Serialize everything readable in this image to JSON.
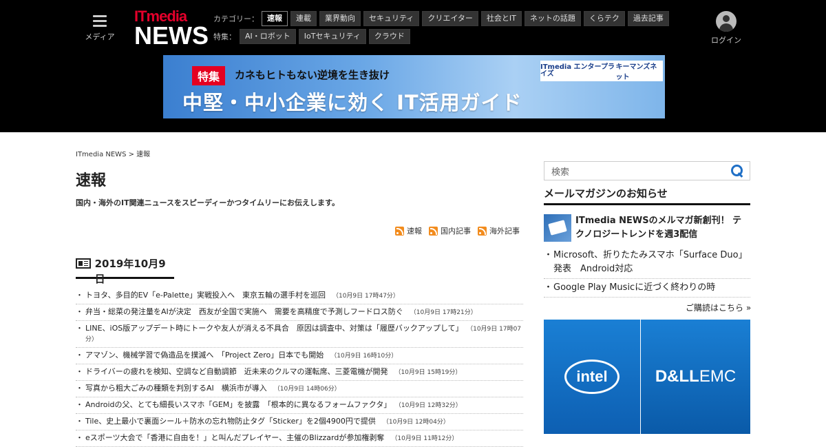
{
  "header": {
    "menu_label": "メディア",
    "logo_top": "ITmedia",
    "logo_bottom": "NEWS",
    "category_label": "カテゴリー：",
    "categories": [
      "速報",
      "連載",
      "業界動向",
      "セキュリティ",
      "クリエイター",
      "社会とIT",
      "ネットの話題",
      "くらテク",
      "過去記事"
    ],
    "feature_label": "特集：",
    "features": [
      "AI・ロボット",
      "IoTセキュリティ",
      "クラウド"
    ],
    "login_label": "ログイン"
  },
  "banner": {
    "tag": "特集",
    "subtitle": "カネもヒトもない逆境を生き抜け",
    "headline": "中堅・中小企業に効く IT活用ガイド",
    "sponsor1": "ITmedia エンタープライズ",
    "sponsor2": "キーマンズネット"
  },
  "breadcrumb": "ITmedia NEWS > 速報",
  "page_title": "速報",
  "lead": "国内・海外のIT関連ニュースをスピーディーかつタイムリーにお伝えします。",
  "feeds": [
    "速報",
    "国内記事",
    "海外記事"
  ],
  "date_heading": "2019年10月9日",
  "news": [
    {
      "title": "トヨタ、多目的EV「e-Palette」実戦投入へ　東京五輪の選手村を巡回",
      "time": "（10月9日 17時47分）"
    },
    {
      "title": "弁当・総菜の発注量をAIが決定　西友が全国で実施へ　需要を高精度で予測しフードロス防ぐ",
      "time": "（10月9日 17時21分）"
    },
    {
      "title": "LINE、iOS版アップデート時にトークや友人が消える不具合　原因は調査中、対策は「履歴バックアップして」",
      "time": "（10月9日 17時07分）"
    },
    {
      "title": "アマゾン、機械学習で偽造品を撲滅へ　「Project Zero」日本でも開始",
      "time": "（10月9日 16時10分）"
    },
    {
      "title": "ドライバーの疲れを検知、空調など自動調節　近未来のクルマの運転席、三菱電機が開発",
      "time": "（10月9日 15時19分）"
    },
    {
      "title": "写真から粗大ごみの種類を判別するAI　横浜市が導入",
      "time": "（10月9日 14時06分）"
    },
    {
      "title": "Androidの父、とても細長いスマホ「GEM」を披露　「根本的に異なるフォームファクタ」",
      "time": "（10月9日 12時32分）"
    },
    {
      "title": "Tile、史上最小で裏面シール＋防水の忘れ物防止タグ「Sticker」を2個4900円で提供",
      "time": "（10月9日 12時04分）"
    },
    {
      "title": "eスポーツ大会で「香港に自由を！」と叫んだプレイヤー、主催のBlizzardが参加権剥奪",
      "time": "（10月9日 11時12分）"
    }
  ],
  "sidebar": {
    "search_placeholder": "検索",
    "mm_title": "メールマガジンのお知らせ",
    "mm_promo": "ITmedia NEWSのメルマガ新創刊！ テクノロジートレンドを週3配信",
    "mm_items": [
      "Microsoft、折りたたみスマホ「Surface Duo」発表　Android対応",
      "Google Play Musicに近づく終わりの時"
    ],
    "subscribe": "ご購読はこちら »",
    "ad_left": "intel",
    "ad_right_a": "D&LL",
    "ad_right_b": "EMC"
  }
}
